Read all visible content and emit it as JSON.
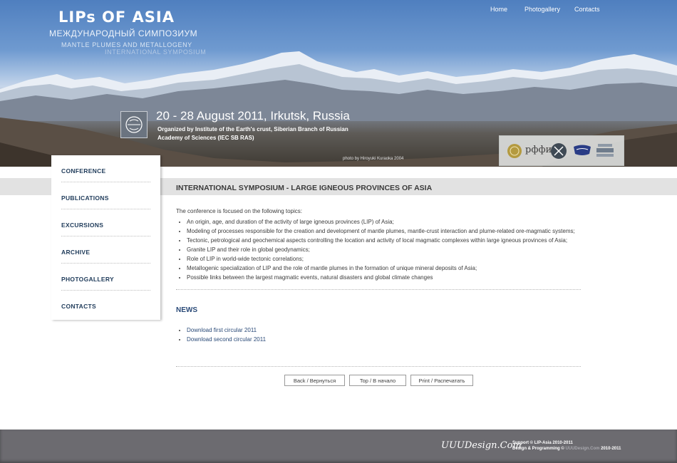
{
  "header": {
    "logo_title": "LIPs OF ASIA",
    "logo_subtitle_ru": "МЕЖДУНАРОДНЫЙ СИМПОЗИУМ",
    "logo_subtitle_en": "MANTLE PLUMES AND METALLOGENY",
    "logo_subtitle_en2": "INTERNATIONAL SYMPOSIUM",
    "event_date": "20 - 28 August 2011, Irkutsk, Russia",
    "organizer": "Organized by Institute of the Earth's crust, Siberian Branch of Russian Academy of Sciences (IEC SB RAS)",
    "photo_credit": "photo by Hiroyuki Kuraoka 2004",
    "sponsor_rffi": "рффи"
  },
  "top_nav": [
    "Home",
    "Photogallery",
    "Contacts"
  ],
  "sidebar": {
    "items": [
      {
        "label": "CONFERENCE"
      },
      {
        "label": "PUBLICATIONS"
      },
      {
        "label": "EXCURSIONS"
      },
      {
        "label": "ARCHIVE"
      },
      {
        "label": "PHOTOGALLERY"
      },
      {
        "label": "CONTACTS"
      }
    ]
  },
  "main": {
    "title": "INTERNATIONAL SYMPOSIUM - LARGE IGNEOUS PROVINCES OF ASIA",
    "intro": "The conference is focused on the following topics:",
    "topics": [
      "An origin, age, and duration of the activity of large    igneous provinces (LIP) of Asia;",
      "Modeling of processes responsible for the creation and development of mantle plumes, mantle-crust interaction and plume-related ore-magmatic systems;",
      "Tectonic, petrological and geochemical aspects controlling the location and activity of local magmatic complexes within large igneous provinces of Asia;",
      "Granite LIP and their role in global geodynamics;",
      "Role of LIP in world-wide tectonic correlations;",
      "Metallogenic specialization of LIP and the role of mantle plumes in the formation of unique mineral deposits of Asia;",
      "Possible links between the largest magmatic events, natural disasters and global climate changes"
    ],
    "news_title": "NEWS",
    "news": [
      "Download first circular 2011",
      "Download second circular 2011"
    ],
    "buttons": {
      "back": "Back / Вернуться",
      "top": "Top / В начало",
      "print": "Print / Распечатать"
    }
  },
  "footer": {
    "logo": "UUUDesign.Com",
    "support": "Support © LIP-Asia 2010-2011",
    "design_prefix": "Design & Programming ©",
    "design_site": "UUUDesign.Com",
    "design_years": "2010-2011"
  }
}
